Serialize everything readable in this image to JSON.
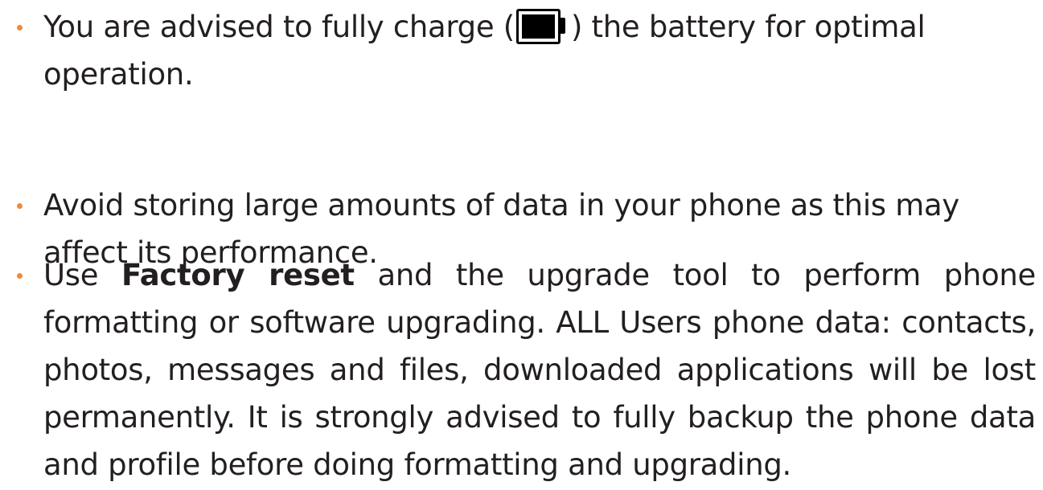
{
  "colors": {
    "text": "#231f20",
    "bullet": "#f08a3a",
    "battery": "#000000"
  },
  "items": [
    {
      "before_icon": "You are advised to fully charge (",
      "icon": "battery-full-icon",
      "after_icon": ") the battery for optimal operation."
    },
    {
      "text": "Avoid storing large amounts of data in your phone as this may affect its performance."
    },
    {
      "bold_text": "Factory reset",
      "prefix": "Use ",
      "suffix": " and the upgrade tool to perform phone formatting or software upgrading. ALL Users phone data: contacts, photos, messages and files, downloaded applications will be lost permanently. It is strongly advised to fully backup the phone data and profile before doing formatting and upgrading."
    }
  ]
}
